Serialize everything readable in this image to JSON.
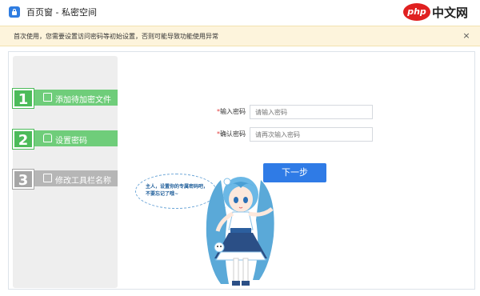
{
  "titlebar": {
    "title": "百页窗 - 私密空间",
    "app_icon": "lock-icon",
    "watermark": {
      "logo": "php",
      "text": "中文网"
    }
  },
  "notice": {
    "text": "首次使用，您需要设置访问密码等初始设置，否则可能导致功能使用异常",
    "close_label": "×",
    "background_color": "#fdf4dc"
  },
  "steps": [
    {
      "number": "1",
      "label": "添加待加密文件",
      "icon": "folder-icon",
      "state": "active"
    },
    {
      "number": "2",
      "label": "设置密码",
      "icon": "lock-icon",
      "state": "active"
    },
    {
      "number": "3",
      "label": "修改工具栏名称",
      "icon": "edit-icon",
      "state": "inactive"
    }
  ],
  "form": {
    "password": {
      "label": "输入密码",
      "required_mark": "*",
      "placeholder": "请输入密码"
    },
    "confirm": {
      "label": "确认密码",
      "required_mark": "*",
      "placeholder": "请再次输入密码"
    },
    "next_label": "下一步"
  },
  "illustration": {
    "speech": "主人，设置你的专属密码吧，不要忘记了哦~"
  },
  "colors": {
    "accent": "#2f7be6",
    "step_active": "#4cbb5a",
    "step_inactive": "#a6a6a6",
    "required": "#e23b3b"
  }
}
